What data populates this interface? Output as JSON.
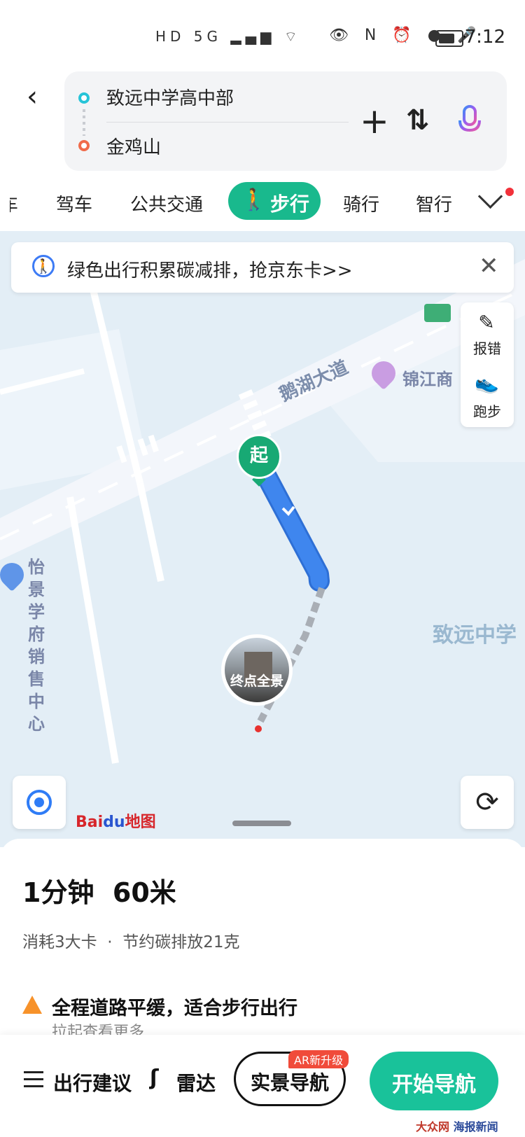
{
  "status_bar": {
    "left_icons": "HD 5G ▂▄▆ ⌔",
    "right_icons": "👁 N ⏰ ● 🎤",
    "time": "7:12"
  },
  "route": {
    "start": "致远中学高中部",
    "end": "金鸡山",
    "back_icon": "‹",
    "add_icon": "+",
    "swap_icon": "⇅"
  },
  "tabs": {
    "partial": "车",
    "drive": "驾车",
    "transit": "公共交通",
    "walk": "步行",
    "ride": "骑行",
    "smart": "智行"
  },
  "promo": {
    "text": "绿色出行积累碳减排，抢京东卡>>",
    "close": "✕"
  },
  "tools": {
    "report": "报错",
    "run": "跑步"
  },
  "map": {
    "road": "鹅湖大道",
    "poi_hotel": "锦江商",
    "poi_sales_line1": "怡景学府",
    "poi_sales_line2": "销售中心",
    "school": "致远中学",
    "start_marker": "起",
    "pano_label": "终点全景",
    "logo_bai": "Bai",
    "logo_du": "du",
    "logo_map": "地图",
    "colors": {
      "route_blue": "#3f86ee",
      "walk_gray": "#a9aeb5",
      "accent_green": "#19b98d"
    }
  },
  "summary": {
    "time_distance": "1分钟  60米",
    "stats": "消耗3大卡  ·  节约碳排放21克",
    "notice": "全程道路平缓，适合步行出行",
    "pull": "拉起查看更多"
  },
  "actions": {
    "advice": "出行建议",
    "radar": "雷达",
    "ar_nav": "实景导航",
    "ar_badge": "AR新升级",
    "start_nav": "开始导航"
  },
  "watermark": {
    "left": "大众网",
    "right": "海报新闻"
  }
}
